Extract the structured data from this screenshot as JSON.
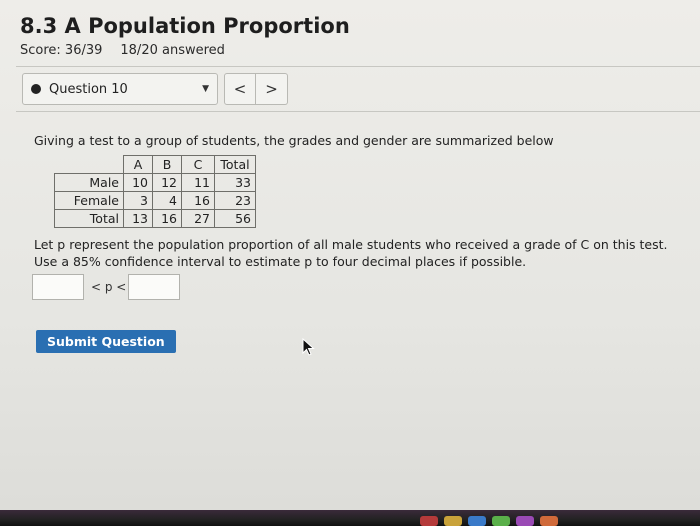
{
  "header": {
    "title": "8.3 A Population Proportion",
    "score": "Score: 36/39",
    "answered": "18/20 answered"
  },
  "question_nav": {
    "selected": "Question 10",
    "prev_icon": "chevron-left-icon",
    "next_icon": "chevron-right-icon",
    "prev_glyph": "<",
    "next_glyph": ">"
  },
  "question": {
    "stem": "Giving a test to a group of students, the grades and gender are summarized below",
    "table": {
      "headers": [
        "",
        "A",
        "B",
        "C",
        "Total"
      ],
      "rows": [
        [
          "Male",
          "10",
          "12",
          "11",
          "33"
        ],
        [
          "Female",
          "3",
          "4",
          "16",
          "23"
        ],
        [
          "Total",
          "13",
          "16",
          "27",
          "56"
        ]
      ]
    },
    "prompt": "Let p represent the population proportion of all male students who received a grade of C on this test. Use a 85% confidence interval to estimate p to four decimal places if possible.",
    "lower_value": "",
    "upper_value": "",
    "inequality": "< p <"
  },
  "submit_label": "Submit Question"
}
